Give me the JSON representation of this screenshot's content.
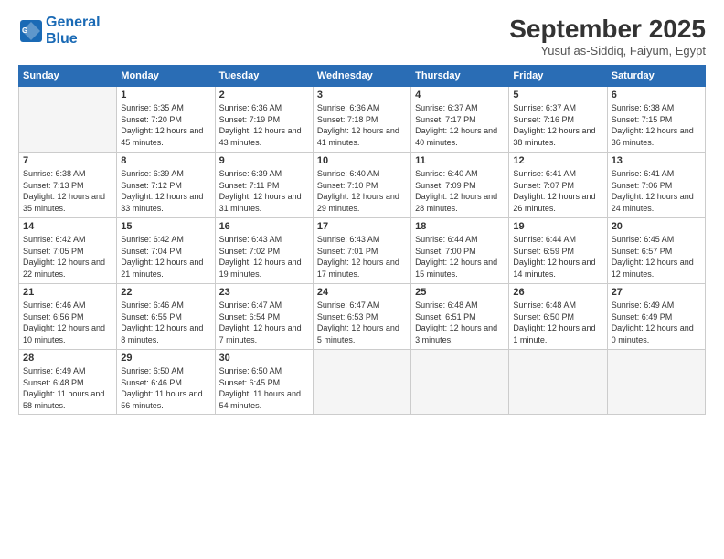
{
  "header": {
    "logo_line1": "General",
    "logo_line2": "Blue",
    "month_title": "September 2025",
    "location": "Yusuf as-Siddiq, Faiyum, Egypt"
  },
  "weekdays": [
    "Sunday",
    "Monday",
    "Tuesday",
    "Wednesday",
    "Thursday",
    "Friday",
    "Saturday"
  ],
  "weeks": [
    [
      {
        "day": "",
        "sunrise": "",
        "sunset": "",
        "daylight": ""
      },
      {
        "day": "1",
        "sunrise": "Sunrise: 6:35 AM",
        "sunset": "Sunset: 7:20 PM",
        "daylight": "Daylight: 12 hours and 45 minutes."
      },
      {
        "day": "2",
        "sunrise": "Sunrise: 6:36 AM",
        "sunset": "Sunset: 7:19 PM",
        "daylight": "Daylight: 12 hours and 43 minutes."
      },
      {
        "day": "3",
        "sunrise": "Sunrise: 6:36 AM",
        "sunset": "Sunset: 7:18 PM",
        "daylight": "Daylight: 12 hours and 41 minutes."
      },
      {
        "day": "4",
        "sunrise": "Sunrise: 6:37 AM",
        "sunset": "Sunset: 7:17 PM",
        "daylight": "Daylight: 12 hours and 40 minutes."
      },
      {
        "day": "5",
        "sunrise": "Sunrise: 6:37 AM",
        "sunset": "Sunset: 7:16 PM",
        "daylight": "Daylight: 12 hours and 38 minutes."
      },
      {
        "day": "6",
        "sunrise": "Sunrise: 6:38 AM",
        "sunset": "Sunset: 7:15 PM",
        "daylight": "Daylight: 12 hours and 36 minutes."
      }
    ],
    [
      {
        "day": "7",
        "sunrise": "Sunrise: 6:38 AM",
        "sunset": "Sunset: 7:13 PM",
        "daylight": "Daylight: 12 hours and 35 minutes."
      },
      {
        "day": "8",
        "sunrise": "Sunrise: 6:39 AM",
        "sunset": "Sunset: 7:12 PM",
        "daylight": "Daylight: 12 hours and 33 minutes."
      },
      {
        "day": "9",
        "sunrise": "Sunrise: 6:39 AM",
        "sunset": "Sunset: 7:11 PM",
        "daylight": "Daylight: 12 hours and 31 minutes."
      },
      {
        "day": "10",
        "sunrise": "Sunrise: 6:40 AM",
        "sunset": "Sunset: 7:10 PM",
        "daylight": "Daylight: 12 hours and 29 minutes."
      },
      {
        "day": "11",
        "sunrise": "Sunrise: 6:40 AM",
        "sunset": "Sunset: 7:09 PM",
        "daylight": "Daylight: 12 hours and 28 minutes."
      },
      {
        "day": "12",
        "sunrise": "Sunrise: 6:41 AM",
        "sunset": "Sunset: 7:07 PM",
        "daylight": "Daylight: 12 hours and 26 minutes."
      },
      {
        "day": "13",
        "sunrise": "Sunrise: 6:41 AM",
        "sunset": "Sunset: 7:06 PM",
        "daylight": "Daylight: 12 hours and 24 minutes."
      }
    ],
    [
      {
        "day": "14",
        "sunrise": "Sunrise: 6:42 AM",
        "sunset": "Sunset: 7:05 PM",
        "daylight": "Daylight: 12 hours and 22 minutes."
      },
      {
        "day": "15",
        "sunrise": "Sunrise: 6:42 AM",
        "sunset": "Sunset: 7:04 PM",
        "daylight": "Daylight: 12 hours and 21 minutes."
      },
      {
        "day": "16",
        "sunrise": "Sunrise: 6:43 AM",
        "sunset": "Sunset: 7:02 PM",
        "daylight": "Daylight: 12 hours and 19 minutes."
      },
      {
        "day": "17",
        "sunrise": "Sunrise: 6:43 AM",
        "sunset": "Sunset: 7:01 PM",
        "daylight": "Daylight: 12 hours and 17 minutes."
      },
      {
        "day": "18",
        "sunrise": "Sunrise: 6:44 AM",
        "sunset": "Sunset: 7:00 PM",
        "daylight": "Daylight: 12 hours and 15 minutes."
      },
      {
        "day": "19",
        "sunrise": "Sunrise: 6:44 AM",
        "sunset": "Sunset: 6:59 PM",
        "daylight": "Daylight: 12 hours and 14 minutes."
      },
      {
        "day": "20",
        "sunrise": "Sunrise: 6:45 AM",
        "sunset": "Sunset: 6:57 PM",
        "daylight": "Daylight: 12 hours and 12 minutes."
      }
    ],
    [
      {
        "day": "21",
        "sunrise": "Sunrise: 6:46 AM",
        "sunset": "Sunset: 6:56 PM",
        "daylight": "Daylight: 12 hours and 10 minutes."
      },
      {
        "day": "22",
        "sunrise": "Sunrise: 6:46 AM",
        "sunset": "Sunset: 6:55 PM",
        "daylight": "Daylight: 12 hours and 8 minutes."
      },
      {
        "day": "23",
        "sunrise": "Sunrise: 6:47 AM",
        "sunset": "Sunset: 6:54 PM",
        "daylight": "Daylight: 12 hours and 7 minutes."
      },
      {
        "day": "24",
        "sunrise": "Sunrise: 6:47 AM",
        "sunset": "Sunset: 6:53 PM",
        "daylight": "Daylight: 12 hours and 5 minutes."
      },
      {
        "day": "25",
        "sunrise": "Sunrise: 6:48 AM",
        "sunset": "Sunset: 6:51 PM",
        "daylight": "Daylight: 12 hours and 3 minutes."
      },
      {
        "day": "26",
        "sunrise": "Sunrise: 6:48 AM",
        "sunset": "Sunset: 6:50 PM",
        "daylight": "Daylight: 12 hours and 1 minute."
      },
      {
        "day": "27",
        "sunrise": "Sunrise: 6:49 AM",
        "sunset": "Sunset: 6:49 PM",
        "daylight": "Daylight: 12 hours and 0 minutes."
      }
    ],
    [
      {
        "day": "28",
        "sunrise": "Sunrise: 6:49 AM",
        "sunset": "Sunset: 6:48 PM",
        "daylight": "Daylight: 11 hours and 58 minutes."
      },
      {
        "day": "29",
        "sunrise": "Sunrise: 6:50 AM",
        "sunset": "Sunset: 6:46 PM",
        "daylight": "Daylight: 11 hours and 56 minutes."
      },
      {
        "day": "30",
        "sunrise": "Sunrise: 6:50 AM",
        "sunset": "Sunset: 6:45 PM",
        "daylight": "Daylight: 11 hours and 54 minutes."
      },
      {
        "day": "",
        "sunrise": "",
        "sunset": "",
        "daylight": ""
      },
      {
        "day": "",
        "sunrise": "",
        "sunset": "",
        "daylight": ""
      },
      {
        "day": "",
        "sunrise": "",
        "sunset": "",
        "daylight": ""
      },
      {
        "day": "",
        "sunrise": "",
        "sunset": "",
        "daylight": ""
      }
    ]
  ]
}
